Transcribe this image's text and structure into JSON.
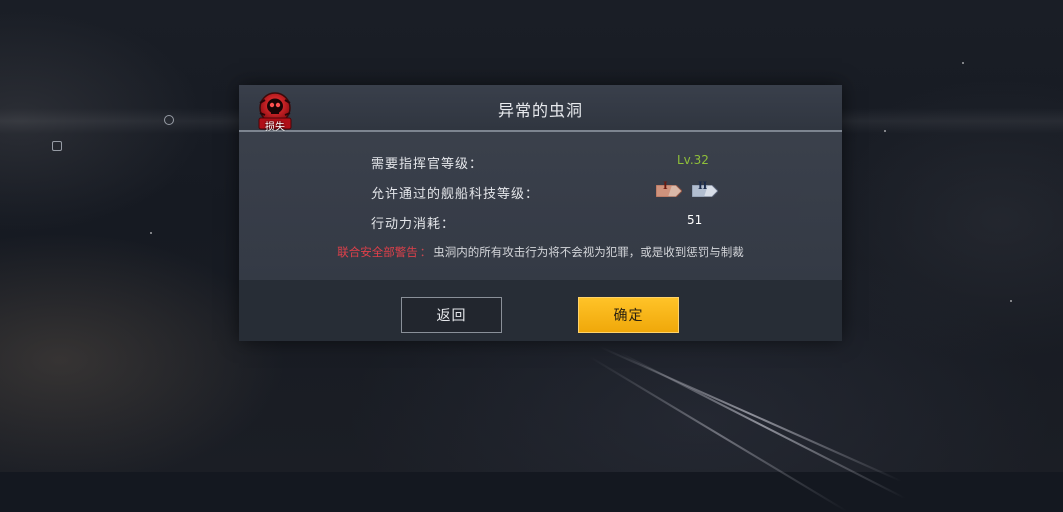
{
  "dialog": {
    "title": "异常的虫洞",
    "badge_label": "损失",
    "rows": [
      {
        "label": "需要指挥官等级：",
        "value": "Lv.32"
      },
      {
        "label": "允许通过的舰船科技等级：",
        "icons": [
          "I",
          "II"
        ]
      },
      {
        "label": "行动力消耗：",
        "value": "51"
      }
    ],
    "warning": {
      "label": "联合安全部警告",
      "separator": "：",
      "text": "虫洞内的所有攻击行为将不会视为犯罪，或是收到惩罚与制裁"
    },
    "buttons": {
      "back": "返回",
      "confirm": "确定"
    }
  },
  "colors": {
    "level_value": "#8fbf3a",
    "warning_label": "#e0404a",
    "confirm_button": "#f5b014",
    "badge_red": "#c8141e"
  },
  "icons": {
    "badge": "skull-icon",
    "tech_tier_1": "tier-1-tag-icon",
    "tech_tier_2": "tier-2-tag-icon"
  }
}
